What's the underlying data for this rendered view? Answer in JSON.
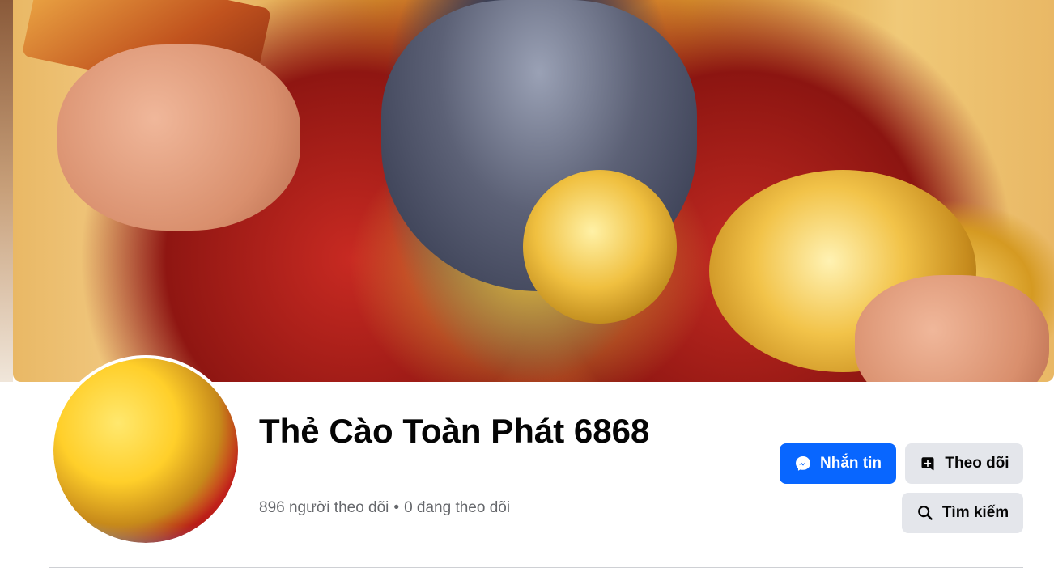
{
  "profile": {
    "name": "Thẻ Cào Toàn Phát 6868",
    "followers_text": "896 người theo dõi",
    "separator": "•",
    "following_text": "0 đang theo dõi"
  },
  "actions": {
    "message_label": "Nhắn tin",
    "follow_label": "Theo dõi",
    "search_label": "Tìm kiếm"
  },
  "icons": {
    "message": "messenger-icon",
    "follow": "follow-plus-icon",
    "search": "search-icon"
  },
  "colors": {
    "primary": "#0866ff",
    "secondary_button": "#e4e6eb",
    "text_secondary": "#65676b"
  }
}
